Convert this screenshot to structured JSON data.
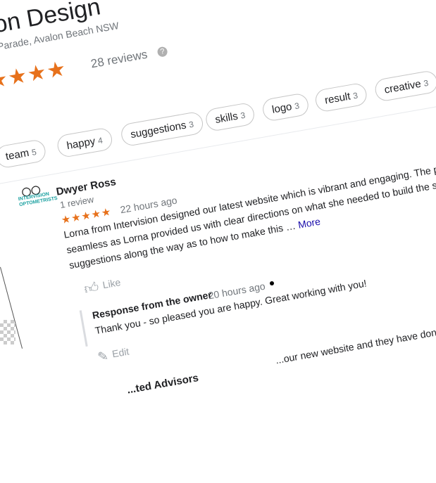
{
  "business": {
    "title": "vision Design",
    "address": "Avalon Parade, Avalon Beach NSW",
    "rating_stars": "★★★★★",
    "reviews_label": "28 reviews",
    "help_glyph": "?"
  },
  "chips": [
    {
      "label": "team",
      "count": "5"
    },
    {
      "label": "happy",
      "count": "4"
    },
    {
      "label": "suggestions",
      "count": "3"
    },
    {
      "label": "skills",
      "count": "3"
    },
    {
      "label": "logo",
      "count": "3"
    },
    {
      "label": "result",
      "count": "3"
    },
    {
      "label": "creative",
      "count": "3"
    }
  ],
  "review": {
    "avatar_text": "INTERVISION OPTOMETRISTS",
    "reviewer_name": "Dwyer Ross",
    "reviewer_sub": "1 review",
    "stars": "★★★★★",
    "time": "22 hours ago",
    "lines": [
      "Lorna from Intervision designed our latest website which is vibrant and engaging. The process was",
      "seamless as Lorna provided us with clear directions on what she needed to build the site and",
      "suggestions along the way as to how to make this …"
    ],
    "more_label": "More",
    "like_label": "Like",
    "owner_response_label": "Response from the owner",
    "owner_response_time": "20 hours ago",
    "owner_response_text": "Thank you - so pleased you are happy. Great working with you!",
    "edit_label": "Edit"
  },
  "next_review": {
    "name": "...ted Advisors",
    "text_fragment": "...our new website and they have done a fabulous jo..."
  },
  "icons": {
    "help": "help-icon",
    "like": "thumbs-up-icon",
    "edit": "pencil-icon",
    "star_color": "#e7711b"
  }
}
